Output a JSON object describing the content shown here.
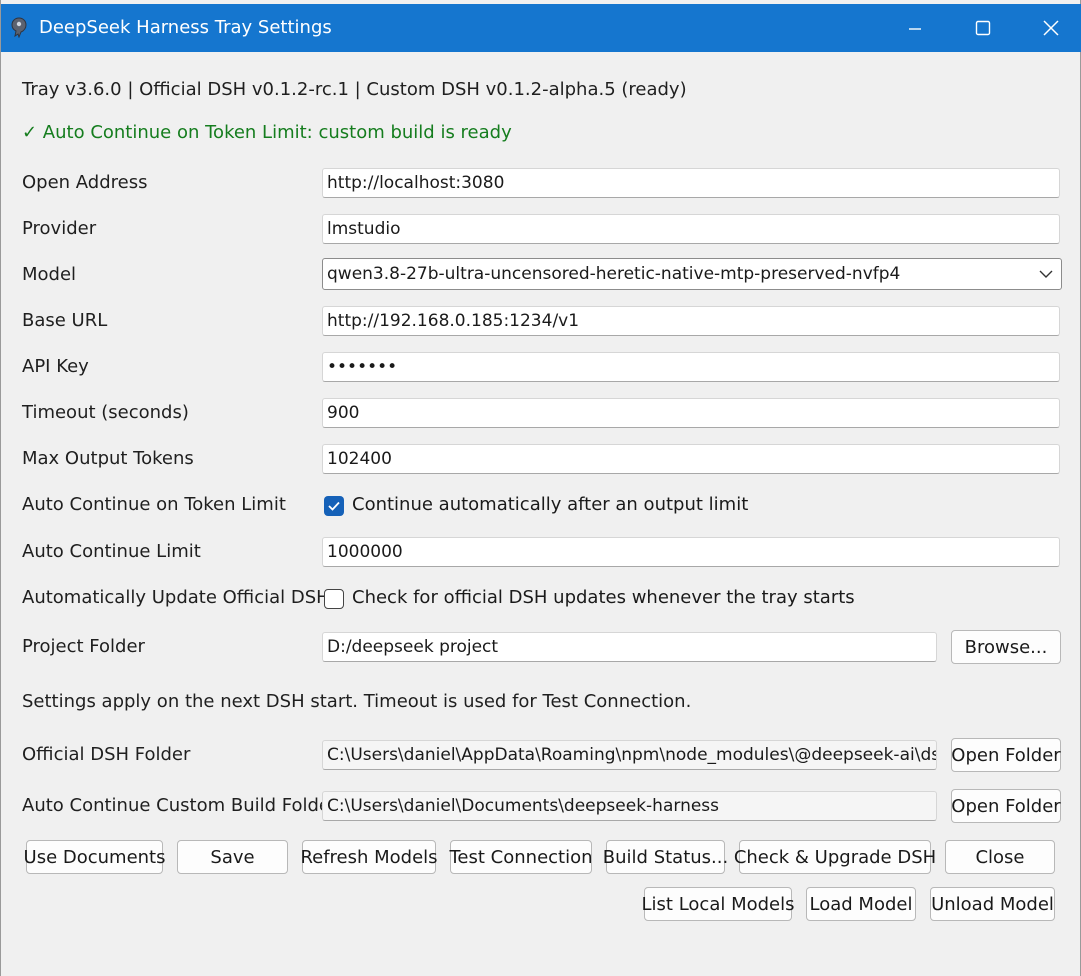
{
  "window": {
    "title": "DeepSeek Harness Tray Settings"
  },
  "version_line": "Tray v3.6.0   |   Official DSH v0.1.2-rc.1   |   Custom DSH v0.1.2-alpha.5 (ready)",
  "status_line": "✓ Auto Continue on Token Limit: custom build is ready",
  "fields": {
    "open_address": {
      "label": "Open Address",
      "value": "http://localhost:3080"
    },
    "provider": {
      "label": "Provider",
      "value": "lmstudio"
    },
    "model": {
      "label": "Model",
      "value": "qwen3.8-27b-ultra-uncensored-heretic-native-mtp-preserved-nvfp4"
    },
    "base_url": {
      "label": "Base URL",
      "value": "http://192.168.0.185:1234/v1"
    },
    "api_key": {
      "label": "API Key",
      "value": "•••••••"
    },
    "timeout": {
      "label": "Timeout (seconds)",
      "value": "900"
    },
    "max_output_tokens": {
      "label": "Max Output Tokens",
      "value": "102400"
    },
    "auto_continue": {
      "label": "Auto Continue on Token Limit",
      "checkbox_label": "Continue automatically after an output limit",
      "checked": true
    },
    "auto_continue_limit": {
      "label": "Auto Continue Limit",
      "value": "1000000"
    },
    "auto_update": {
      "label": "Automatically Update Official DSH",
      "checkbox_label": "Check for official DSH updates whenever the tray starts",
      "checked": false
    },
    "project_folder": {
      "label": "Project Folder",
      "value": "D:/deepseek project",
      "button": "Browse..."
    }
  },
  "note": "Settings apply on the next DSH start. Timeout is used for Test Connection.",
  "folders": {
    "official": {
      "label": "Official DSH Folder",
      "value": "C:\\Users\\daniel\\AppData\\Roaming\\npm\\node_modules\\@deepseek-ai\\dsh",
      "button": "Open Folder"
    },
    "custom": {
      "label": "Auto Continue Custom Build Folder",
      "value": "C:\\Users\\daniel\\Documents\\deepseek-harness",
      "button": "Open Folder"
    }
  },
  "buttons": {
    "use_documents": "Use Documents",
    "save": "Save",
    "refresh_models": "Refresh Models",
    "test_connection": "Test Connection",
    "build_status": "Build Status...",
    "check_upgrade": "Check & Upgrade DSH",
    "close": "Close",
    "list_local_models": "List Local Models",
    "load_model": "Load Model",
    "unload_model": "Unload Model"
  },
  "colors": {
    "titlebar": "#1576cf",
    "status_green": "#157d1e",
    "checkbox_accent": "#1561b8"
  }
}
